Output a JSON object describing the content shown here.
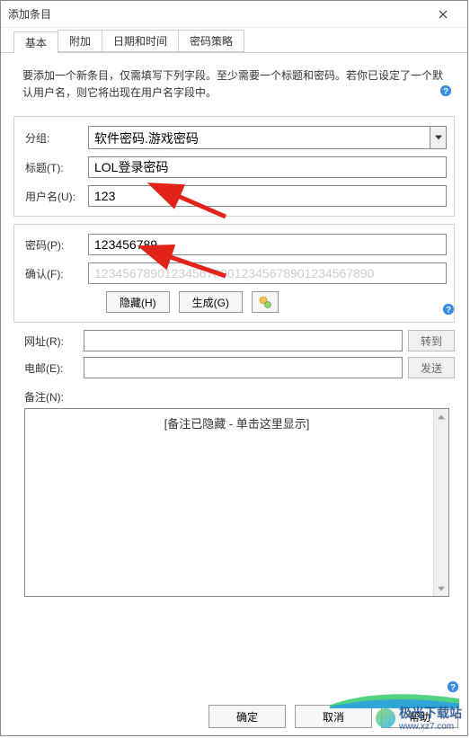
{
  "window": {
    "title": "添加条目"
  },
  "tabs": {
    "items": [
      "基本",
      "附加",
      "日期和时间",
      "密码策略"
    ],
    "active": 0
  },
  "desc": "要添加一个新条目，仅需填写下列字段。至少需要一个标题和密码。若你已设定了一个默认用户名，则它将出现在用户名字段中。",
  "group_section": {
    "group_label": "分组:",
    "group_value": "软件密码.游戏密码",
    "title_label": "标题(T):",
    "title_value": "LOL登录密码",
    "user_label": "用户名(U):",
    "user_value": "123"
  },
  "pwd_section": {
    "password_label": "密码(P):",
    "password_value": "123456789",
    "confirm_label": "确认(F):",
    "confirm_value": "1234567890123456789012345678901234567890",
    "hide_btn": "隐藏(H)",
    "gen_btn": "生成(G)"
  },
  "url_label": "网址(R):",
  "url_value": "",
  "url_btn": "转到",
  "email_label": "电邮(E):",
  "email_value": "",
  "email_btn": "发送",
  "notes_label": "备注(N):",
  "notes_hidden_text": "[备注已隐藏 - 单击这里显示]",
  "footer": {
    "ok": "确定",
    "cancel": "取消",
    "help": "帮助"
  },
  "watermark": {
    "name": "极光下载站",
    "url": "www.xz7.com"
  }
}
